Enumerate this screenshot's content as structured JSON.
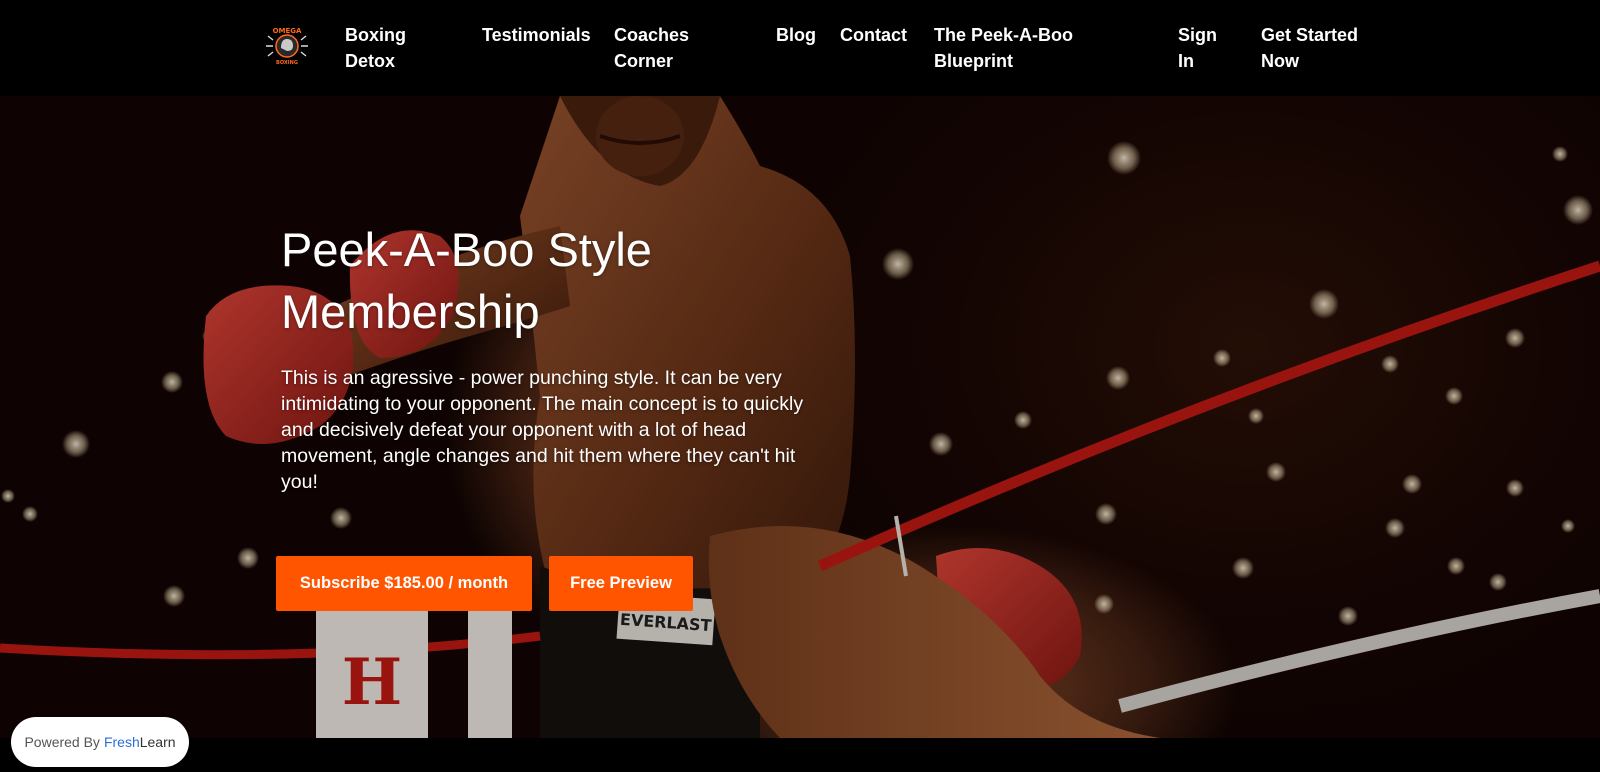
{
  "header": {
    "logo": {
      "text_top": "OMEGA",
      "text_bottom": "BOXING",
      "icon": "boxing-glove-logo-icon"
    },
    "nav": [
      {
        "id": "boxing",
        "label": "Boxing Detox"
      },
      {
        "id": "testimonials",
        "label": "Testimonials"
      },
      {
        "id": "coaches",
        "label": "Coaches Corner"
      },
      {
        "id": "blog",
        "label": "Blog"
      },
      {
        "id": "contact",
        "label": "Contact"
      },
      {
        "id": "peek",
        "label": "The Peek-A-Boo Blueprint"
      },
      {
        "id": "signin",
        "label": "Sign In"
      },
      {
        "id": "started",
        "label": "Get Started Now"
      }
    ]
  },
  "hero": {
    "title": "Peek-A-Boo Style Membership",
    "description": "This is an agressive - power punching style. It can be very intimidating to your opponent. The main concept is to quickly and decisively defeat your opponent with a lot of head movement, angle changes and hit them where they can't hit you!",
    "subscribe_label": "Subscribe $185.00 / month",
    "preview_label": "Free Preview",
    "background": "boxing-ring-photo",
    "corner_pad_text": "H",
    "trunks_text": "EVERLAST"
  },
  "badge": {
    "prefix": "Powered By",
    "brand_part1": "Fresh",
    "brand_part2": "Learn"
  },
  "colors": {
    "accent": "#ff5500",
    "header_bg": "#000000",
    "brand_blue": "#2b6fd6"
  }
}
